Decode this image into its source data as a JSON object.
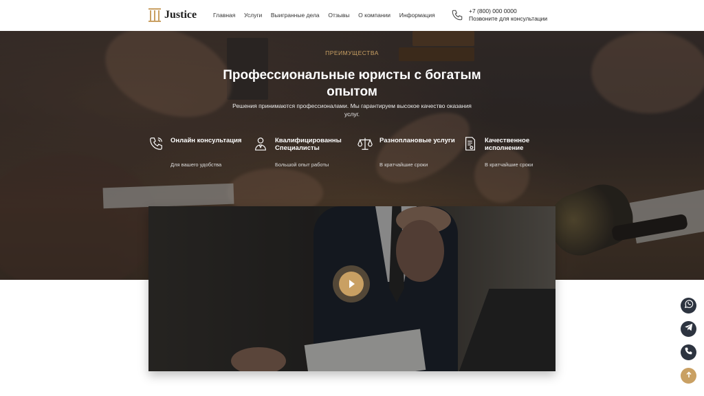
{
  "header": {
    "logo_text": "Justice",
    "nav": [
      "Главная",
      "Услуги",
      "Выигранные дела",
      "Отзывы",
      "О компании",
      "Информация"
    ],
    "phone": "+7 (800) 000 0000",
    "phone_caption": "Позвоните для консультации"
  },
  "hero": {
    "kicker": "ПРЕИМУЩЕСТВА",
    "title": "Профессиональные юристы с богатым опытом",
    "subtitle": "Решения принимаются профессионалами. Мы гарантируем высокое качество оказания услуг.",
    "features": [
      {
        "icon": "phone-icon",
        "title": "Онлайн консультация",
        "subtitle": "Для вашего удобства"
      },
      {
        "icon": "lawyer-icon",
        "title": "Квалифицированны Специалисты",
        "subtitle": "Большой опыт работы"
      },
      {
        "icon": "scales-icon",
        "title": "Разноплановые услуги",
        "subtitle": "В кратчайшие сроки"
      },
      {
        "icon": "document-icon",
        "title": "Качественное исполнение",
        "subtitle": "В кратчайшие сроки"
      }
    ]
  },
  "video": {
    "play_icon": "play-icon"
  },
  "floating": [
    "whatsapp-icon",
    "telegram-icon",
    "phone-icon",
    "arrow-up-icon"
  ],
  "colors": {
    "accent": "#c9a063",
    "dark_button": "#2d3440"
  }
}
